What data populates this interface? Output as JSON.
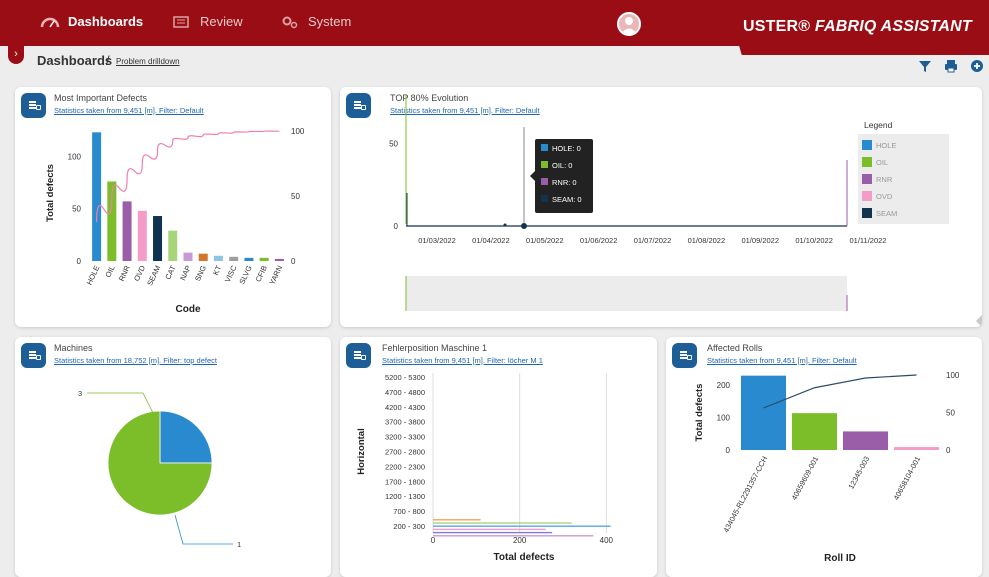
{
  "nav": {
    "dashboards": "Dashboards",
    "review": "Review",
    "system": "System"
  },
  "brand": {
    "name": "USTER®",
    "product": "FABRIQ ASSISTANT"
  },
  "breadcrumb": {
    "title": "Dashboards",
    "separator": "/",
    "link": "Problem drilldown"
  },
  "icons": [
    "speedometer-icon",
    "review-icon",
    "gears-icon",
    "user-avatar",
    "filter-icon",
    "print-icon",
    "add-icon",
    "widget-menu-icon"
  ],
  "colors": {
    "brand_red": "#9b0d14",
    "hole": "#2a8ad0",
    "oil": "#7cbd2a",
    "rnr": "#9a5ea9",
    "ovd": "#f59bc8",
    "seam": "#10344f"
  },
  "cards": {
    "defects": {
      "title": "Most Important Defects",
      "subtitle": "Statistics taken from 9,451 [m]. Filter: Default"
    },
    "evolution": {
      "title": "TOP 80% Evolution",
      "subtitle": "Statistics taken from 9,451 [m]. Filter: Default"
    },
    "machines": {
      "title": "Machines",
      "subtitle": "Statistics taken from 18,752 [m]. Filter: top defect"
    },
    "fehler": {
      "title": "Fehlerposition Maschine 1",
      "subtitle": "Statistics taken from 9,451 [m]. Filter: löcher M 1"
    },
    "rolls": {
      "title": "Affected Rolls",
      "subtitle": "Statistics taken from 9,451 [m]. Filter: Default"
    }
  },
  "chart_data": [
    {
      "id": "most-important-defects",
      "type": "bar",
      "categories": [
        "HOLE",
        "OIL",
        "RNR",
        "OVD",
        "SEAM",
        "CAT",
        "NAP",
        "SNG",
        "KT",
        "VISC",
        "SLVG",
        "CFIB",
        "YARN"
      ],
      "values": [
        123,
        76,
        57,
        48,
        43,
        29,
        8,
        7,
        5,
        4,
        3,
        3,
        2
      ],
      "colors": [
        "#2a8ad0",
        "#7cbd2a",
        "#9a5ea9",
        "#f59bc8",
        "#10344f",
        "#a8d47a",
        "#c89ad6",
        "#d2752a",
        "#8fc4ea",
        "#9e9e9e",
        "#2a8ad0",
        "#7cbd2a",
        "#9a5ea9"
      ],
      "cumulative_pct": [
        30,
        49,
        63,
        75,
        85,
        93,
        95,
        97,
        98,
        99,
        99.5,
        99.8,
        100
      ],
      "xlabel": "Code",
      "ylabel": "Total defects",
      "ylim": [
        0,
        130
      ],
      "yticks": [
        0,
        50,
        100
      ],
      "y2ticks": [
        0,
        50,
        100
      ]
    },
    {
      "id": "top80-evolution",
      "type": "line",
      "x": [
        "01/03/2022",
        "01/04/2022",
        "01/05/2022",
        "01/06/2022",
        "01/07/2022",
        "01/08/2022",
        "01/09/2022",
        "01/10/2022",
        "01/11/2022"
      ],
      "yticks": [
        0,
        50
      ],
      "legend_title": "Legend",
      "legend": [
        "HOLE",
        "OIL",
        "RNR",
        "OVD",
        "SEAM"
      ],
      "tooltip": [
        {
          "label": "HOLE: 0",
          "color": "#2a8ad0"
        },
        {
          "label": "OIL: 0",
          "color": "#7cbd2a"
        },
        {
          "label": "RNR: 0",
          "color": "#9a5ea9"
        },
        {
          "label": "SEAM: 0",
          "color": "#10344f"
        }
      ]
    },
    {
      "id": "machines",
      "type": "pie",
      "values": [
        1,
        3
      ],
      "labels": [
        "1",
        "3"
      ],
      "colors": [
        "#2a8ad0",
        "#7cbd2a"
      ]
    },
    {
      "id": "fehlerposition",
      "type": "bar",
      "orientation": "horizontal",
      "categories": [
        "200 - 300",
        "700 - 800",
        "1200 - 1300",
        "1700 - 1800",
        "2200 - 2300",
        "2700 - 2800",
        "3200 - 3300",
        "3700 - 3800",
        "4200 - 4300",
        "4700 - 4800",
        "5200 - 5300"
      ],
      "ylabel": "Horizontal",
      "xlabel": "Total defects",
      "xticks": [
        0,
        200,
        400
      ],
      "xlim": [
        0,
        420
      ],
      "bars": [
        {
          "value": 110,
          "color": "#f2a65a"
        },
        {
          "value": 320,
          "color": "#a8d47a"
        },
        {
          "value": 410,
          "color": "#5aa9e6"
        },
        {
          "value": 260,
          "color": "#f59bc8"
        },
        {
          "value": 275,
          "color": "#7b7fd6"
        },
        {
          "value": 370,
          "color": "#c89ad6"
        }
      ]
    },
    {
      "id": "affected-rolls",
      "type": "bar",
      "categories": [
        "434045-RL2291357-CCH",
        "40659609-001",
        "12345-003",
        "40658104-001"
      ],
      "values": [
        228,
        113,
        57,
        9
      ],
      "colors": [
        "#2a8ad0",
        "#7cbd2a",
        "#9a5ea9",
        "#f59bc8"
      ],
      "cumulative_pct": [
        56,
        83,
        96,
        100
      ],
      "xlabel": "Roll ID",
      "ylabel": "Total defects",
      "yticks": [
        0,
        100,
        200
      ],
      "y2ticks": [
        0,
        50,
        100
      ],
      "ylim": [
        0,
        230
      ]
    }
  ]
}
